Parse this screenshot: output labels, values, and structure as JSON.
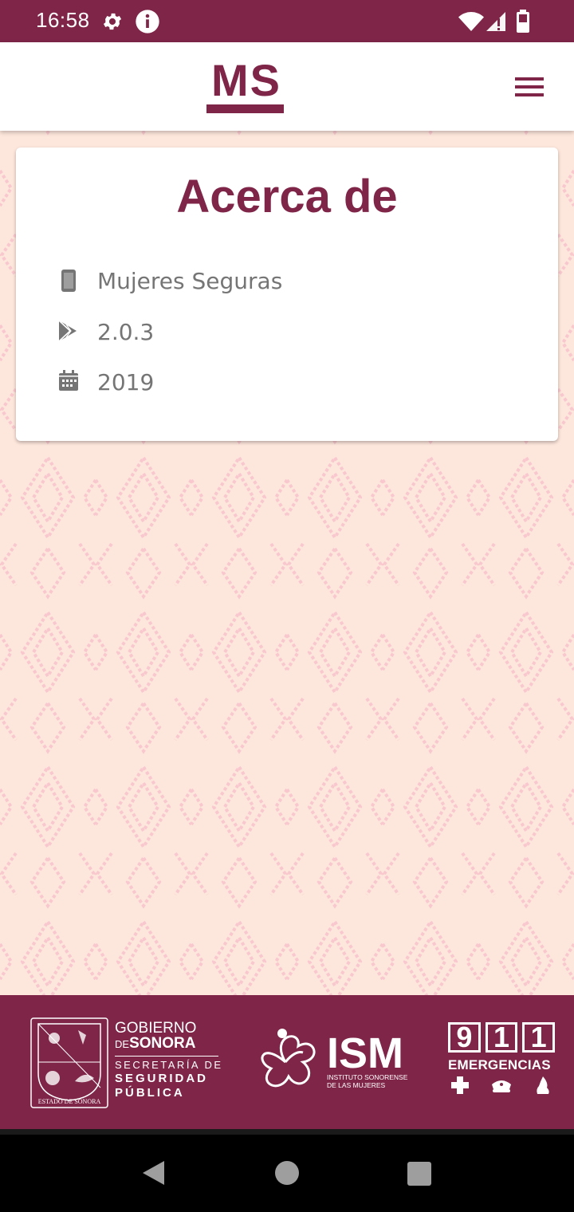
{
  "status_bar": {
    "time": "16:58",
    "icons": [
      "gear-icon",
      "info-icon",
      "wifi-icon",
      "signal-icon",
      "battery-icon"
    ]
  },
  "app_bar": {
    "logo_text": "MS",
    "menu_icon": "hamburger-menu-icon"
  },
  "card": {
    "title": "Acerca de",
    "rows": [
      {
        "icon": "phone-icon",
        "text": "Mujeres Seguras"
      },
      {
        "icon": "play-store-icon",
        "text": "2.0.3"
      },
      {
        "icon": "calendar-icon",
        "text": "2019"
      }
    ]
  },
  "footer": {
    "sonora": {
      "seal_caption": "ESTADO DE SONORA",
      "line1": "GOBIERNO",
      "line2_prefix": "DE",
      "line2": "SONORA",
      "line3": "SECRETARÍA DE",
      "line4": "SEGURIDAD",
      "line5": "PÚBLICA"
    },
    "ism": {
      "acronym": "ISM",
      "line1": "INSTITUTO SONORENSE",
      "line2": "DE LAS MUJERES"
    },
    "emergency": {
      "digits": [
        "9",
        "1",
        "1"
      ],
      "label": "EMERGENCIAS"
    }
  },
  "colors": {
    "brand": "#7f2548",
    "background": "#fde6dc",
    "pattern": "#f6c6cf",
    "text_muted": "#757575"
  },
  "nav_bar": {
    "buttons": [
      "back-button",
      "home-button",
      "recents-button"
    ]
  }
}
